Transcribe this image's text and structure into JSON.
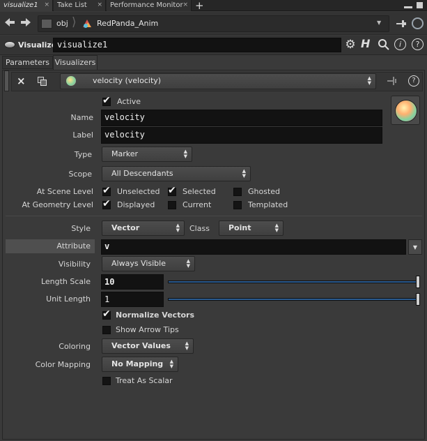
{
  "pane_tabs": [
    {
      "label": "visualize1",
      "close": "×"
    },
    {
      "label": "Take List",
      "close": "×"
    },
    {
      "label": "Performance Monitor",
      "close": "×"
    }
  ],
  "add_tab": "+",
  "path": {
    "root": "obj",
    "node": "RedPanda_Anim"
  },
  "node_header": {
    "type_label": "Visualize",
    "name": "visualize1"
  },
  "param_tabs": [
    "Parameters",
    "Visualizers"
  ],
  "visualizer_select": "velocity (velocity)",
  "active_label": "Active",
  "name": {
    "label": "Name",
    "value": "velocity"
  },
  "label_field": {
    "label": "Label",
    "value": "velocity"
  },
  "type": {
    "label": "Type",
    "value": "Marker"
  },
  "scope": {
    "label": "Scope",
    "value": "All Descendants"
  },
  "scene_level": {
    "label": "At Scene Level",
    "options": [
      {
        "label": "Unselected",
        "checked": true
      },
      {
        "label": "Selected",
        "checked": true
      },
      {
        "label": "Ghosted",
        "checked": false
      }
    ]
  },
  "geometry_level": {
    "label": "At Geometry Level",
    "options": [
      {
        "label": "Displayed",
        "checked": true
      },
      {
        "label": "Current",
        "checked": false
      },
      {
        "label": "Templated",
        "checked": false
      }
    ]
  },
  "style": {
    "label": "Style",
    "value": "Vector"
  },
  "class": {
    "label": "Class",
    "value": "Point"
  },
  "attribute": {
    "label": "Attribute",
    "value": "v"
  },
  "visibility": {
    "label": "Visibility",
    "value": "Always Visible"
  },
  "length_scale": {
    "label": "Length Scale",
    "value": "10",
    "slider_fraction": 1.0
  },
  "unit_length": {
    "label": "Unit Length",
    "value": "1",
    "slider_fraction": 1.0
  },
  "normalize_vectors": {
    "label": "Normalize Vectors",
    "checked": true
  },
  "show_arrow_tips": {
    "label": "Show Arrow Tips",
    "checked": false
  },
  "coloring": {
    "label": "Coloring",
    "value": "Vector Values"
  },
  "color_mapping": {
    "label": "Color Mapping",
    "value": "No Mapping"
  },
  "treat_as_scalar": {
    "label": "Treat As Scalar",
    "checked": false
  },
  "colors": {
    "slider": "#2a5a8f",
    "panel": "#3a3a3a",
    "field": "#121212"
  }
}
